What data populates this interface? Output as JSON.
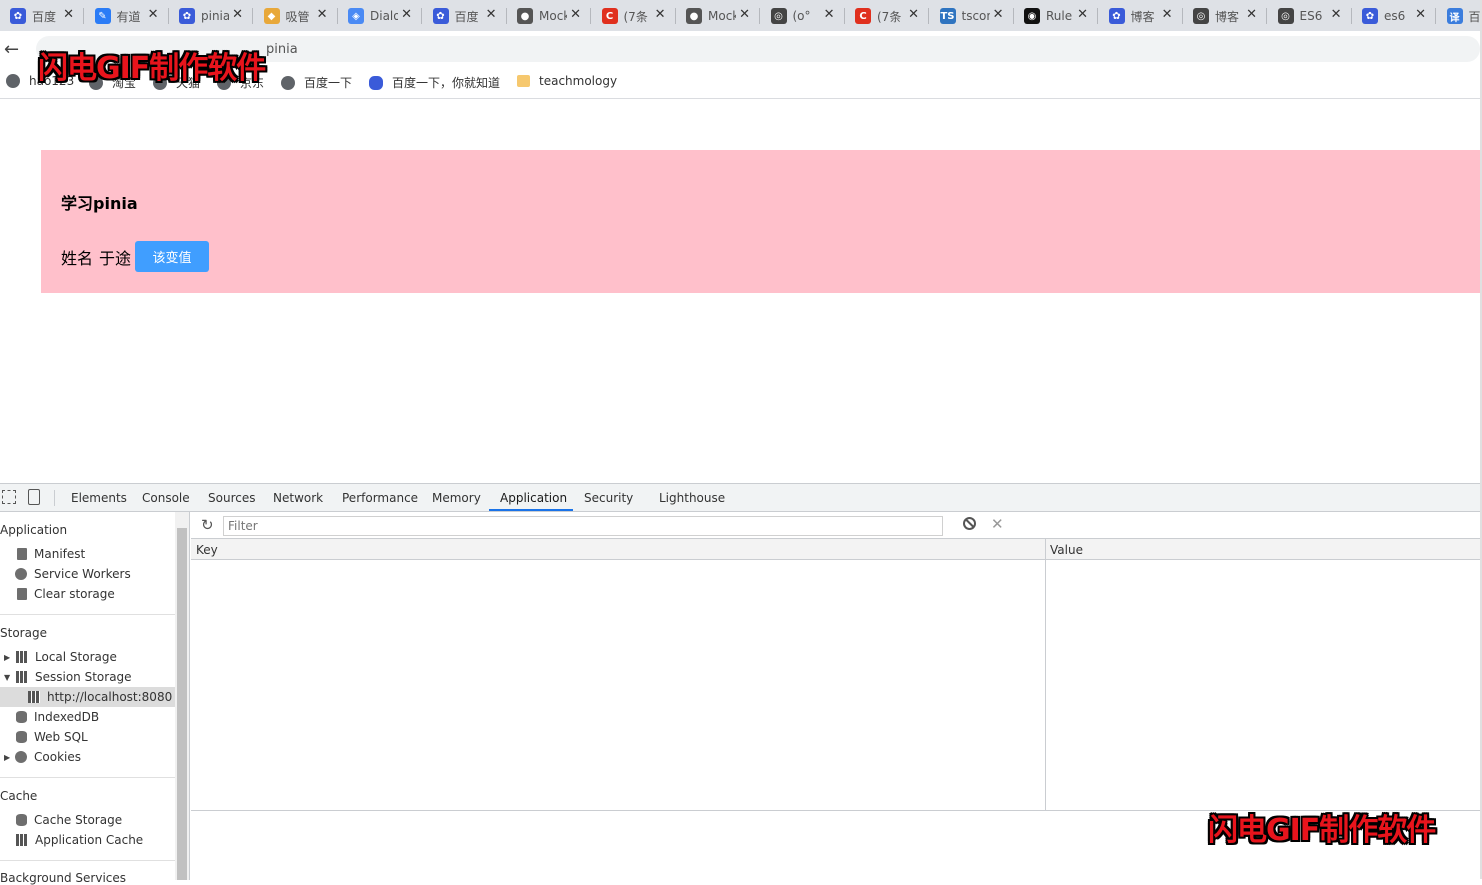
{
  "tabs": [
    {
      "label": "百度",
      "icon": "baidu-paw-icon",
      "color": "#3a5bd9",
      "glyph": "✿"
    },
    {
      "label": "有道",
      "icon": "note-icon",
      "color": "#2b7cf6",
      "glyph": "✎"
    },
    {
      "label": "pinia",
      "icon": "baidu-paw-icon",
      "color": "#3a5bd9",
      "glyph": "✿"
    },
    {
      "label": "吸管",
      "icon": "pineapple-icon",
      "color": "#e8a83a",
      "glyph": "◆"
    },
    {
      "label": "Dialog",
      "icon": "cube-icon",
      "color": "#4a8af4",
      "glyph": "◈"
    },
    {
      "label": "百度",
      "icon": "baidu-paw-icon",
      "color": "#3a5bd9",
      "glyph": "✿"
    },
    {
      "label": "Mock",
      "icon": "fish-icon",
      "color": "#555555",
      "glyph": "●"
    },
    {
      "label": "(7条",
      "icon": "csdn-icon",
      "color": "#e0301e",
      "glyph": "C"
    },
    {
      "label": "Mock",
      "icon": "fish-icon",
      "color": "#555555",
      "glyph": "●"
    },
    {
      "label": "(o°",
      "icon": "swirl-icon",
      "color": "#444444",
      "glyph": "◎"
    },
    {
      "label": "(7条",
      "icon": "csdn-icon",
      "color": "#e0301e",
      "glyph": "C"
    },
    {
      "label": "tsconfig",
      "icon": "typescript-icon",
      "color": "#2f74c0",
      "glyph": "TS"
    },
    {
      "label": "Rule",
      "icon": "github-icon",
      "color": "#111111",
      "glyph": "◉"
    },
    {
      "label": "博客",
      "icon": "baidu-paw-icon",
      "color": "#3a5bd9",
      "glyph": "✿"
    },
    {
      "label": "博客",
      "icon": "swirl-icon",
      "color": "#444444",
      "glyph": "◎"
    },
    {
      "label": "ES6",
      "icon": "swirl-icon",
      "color": "#444444",
      "glyph": "◎"
    },
    {
      "label": "es6",
      "icon": "baidu-paw-icon",
      "color": "#3a5bd9",
      "glyph": "✿"
    },
    {
      "label": "百",
      "icon": "translate-icon",
      "color": "#3b7ddd",
      "glyph": "译"
    }
  ],
  "address_bar": {
    "url_fragment": "pinia"
  },
  "bookmarks": [
    {
      "label": "hao123",
      "icon": "globe-icon"
    },
    {
      "label": "淘宝",
      "icon": "globe-icon"
    },
    {
      "label": "天猫",
      "icon": "globe-icon"
    },
    {
      "label": "京东",
      "icon": "globe-icon"
    },
    {
      "label": "百度一下",
      "icon": "globe-icon"
    },
    {
      "label": "百度一下，你就知道",
      "icon": "baidu-paw-icon"
    },
    {
      "label": "teachmology",
      "icon": "folder-icon"
    }
  ],
  "watermark": "闪电GIF制作软件",
  "page": {
    "heading": "学习pinia",
    "name_label": "姓名",
    "name_value": "于途",
    "change_button": "该变值"
  },
  "devtools": {
    "tabs": [
      "Elements",
      "Console",
      "Sources",
      "Network",
      "Performance",
      "Memory",
      "Application",
      "Security",
      "Lighthouse"
    ],
    "active_tab": "Application",
    "sidebar": {
      "application_title": "Application",
      "application_items": [
        "Manifest",
        "Service Workers",
        "Clear storage"
      ],
      "storage_title": "Storage",
      "storage_items": [
        "Local Storage",
        "Session Storage",
        "http://localhost:8080",
        "IndexedDB",
        "Web SQL",
        "Cookies"
      ],
      "cache_title": "Cache",
      "cache_items": [
        "Cache Storage",
        "Application Cache"
      ],
      "background_title": "Background Services"
    },
    "filter_placeholder": "Filter",
    "columns": {
      "key": "Key",
      "value": "Value"
    }
  },
  "colors": {
    "pink_box": "#ffc0cb",
    "button_blue": "#409eff",
    "active_tab_underline": "#1a73e8"
  }
}
